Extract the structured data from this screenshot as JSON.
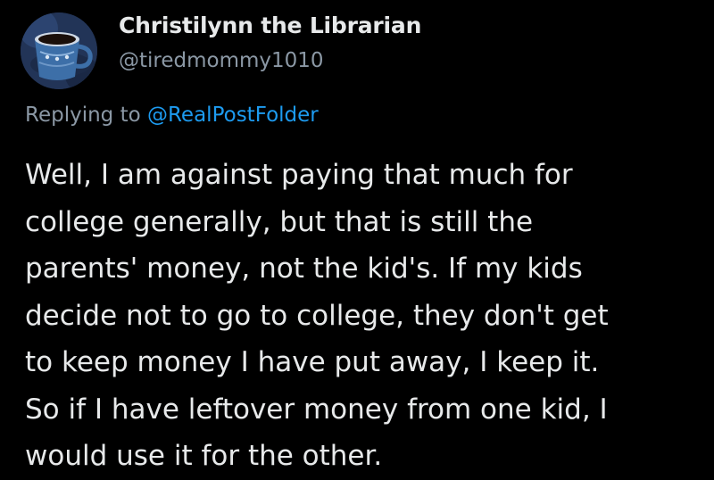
{
  "author": {
    "display_name": "Christilynn the Librarian",
    "handle": "@tiredmommy1010",
    "avatar_icon": "coffee-cup-avatar-icon"
  },
  "reply": {
    "prefix": "Replying to ",
    "mention": "@RealPostFolder"
  },
  "body": {
    "lines": [
      "Well, I am against paying that much for",
      "college generally, but that is still the",
      "parents' money, not the kid's. If my kids",
      "decide not to go to college, they don't get",
      "to keep money I have put away, I keep it.",
      "So if I have leftover money from one kid, I",
      "would use it for the other."
    ]
  },
  "colors": {
    "background": "#000000",
    "primary_text": "#e7e9ea",
    "secondary_text": "#8b98a5",
    "link": "#1d9bf0"
  }
}
